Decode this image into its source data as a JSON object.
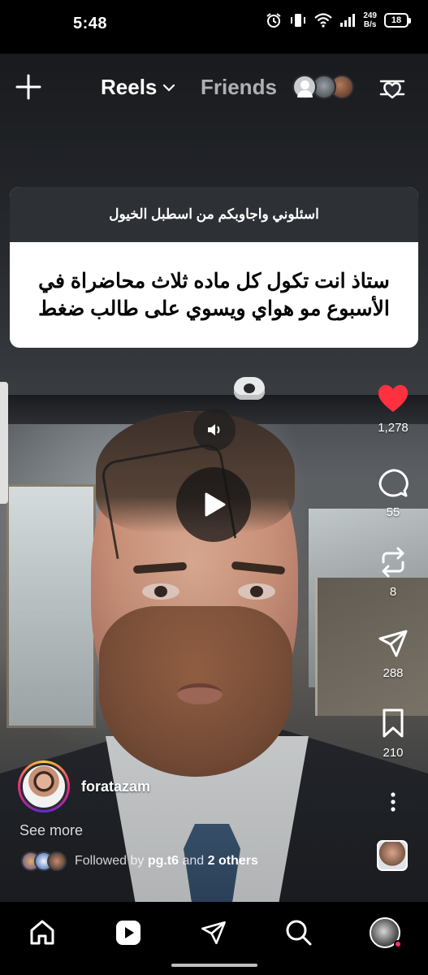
{
  "status_bar": {
    "time": "5:48",
    "net_speed_value": "249",
    "net_speed_unit": "B/s",
    "battery": "18"
  },
  "top_nav": {
    "reels_label": "Reels",
    "friends_label": "Friends"
  },
  "question_card": {
    "header": "اسئلوني واجاوبكم من اسطبل الخيول",
    "body": "ستاذ انت تكول كل ماده ثلاث محاضراة في الأسبوع مو هواي ويسوي على طالب ضغط"
  },
  "actions": {
    "likes": "1,278",
    "comments": "55",
    "reposts": "8",
    "shares": "288",
    "saves": "210"
  },
  "post": {
    "username": "foratazam",
    "see_more": "See more",
    "followed_by_prefix": "Followed by",
    "followed_by_user": "pg.t6",
    "followed_by_and": "and",
    "followed_by_others": "2 others"
  },
  "colors": {
    "like_red": "#ff3040",
    "card_header_bg": "#2d3035",
    "background": "#000000"
  },
  "icons": [
    "plus-icon",
    "chevron-down-icon",
    "filter-heart-icon",
    "speaker-icon",
    "play-icon",
    "heart-icon",
    "comment-icon",
    "repost-icon",
    "send-icon",
    "bookmark-icon",
    "more-vertical-icon",
    "home-icon",
    "reels-icon",
    "paper-plane-icon",
    "search-icon"
  ]
}
